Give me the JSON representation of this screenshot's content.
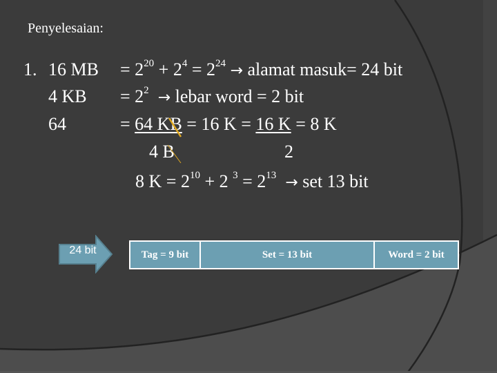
{
  "slide": {
    "title": "Penyelesaian:",
    "item_number": "1.",
    "left_labels": [
      "16 MB",
      "4 KB",
      "64"
    ],
    "line1": {
      "prefix": "= 2",
      "exp1": "20",
      "mid1": " + 2",
      "exp2": "4",
      "mid2": " = 2",
      "exp3": "24",
      "arrow": "→",
      "suffix": " alamat masuk= 24 bit"
    },
    "line2": {
      "prefix": "= 2",
      "exp1": "2",
      "arrow": "→",
      "suffix": " lebar word = 2 bit"
    },
    "line3": {
      "eq1": "= ",
      "frac1_num": "64 KB",
      "eq2": " = 16 K = ",
      "frac2_num": "16 K",
      "eq3": " = 8 K"
    },
    "line4": {
      "frac1_den": "4 B",
      "frac2_den": "2"
    },
    "line5": {
      "prefix": "8 K = 2",
      "exp1": "10",
      "mid1": " + 2 ",
      "exp2": "3",
      "mid2": " = 2",
      "exp3": "13",
      "arrow": "→",
      "suffix": " set 13 bit"
    }
  },
  "address_format": {
    "input_label": "24 bit",
    "fields": [
      {
        "label": "Tag = 9 bit",
        "bits": 9
      },
      {
        "label": "Set = 13 bit",
        "bits": 13
      },
      {
        "label": "Word = 2 bit",
        "bits": 2
      }
    ]
  },
  "colors": {
    "background": "#3b3b3b",
    "field_fill": "#6c9fb2",
    "strike": "#e0a820"
  }
}
